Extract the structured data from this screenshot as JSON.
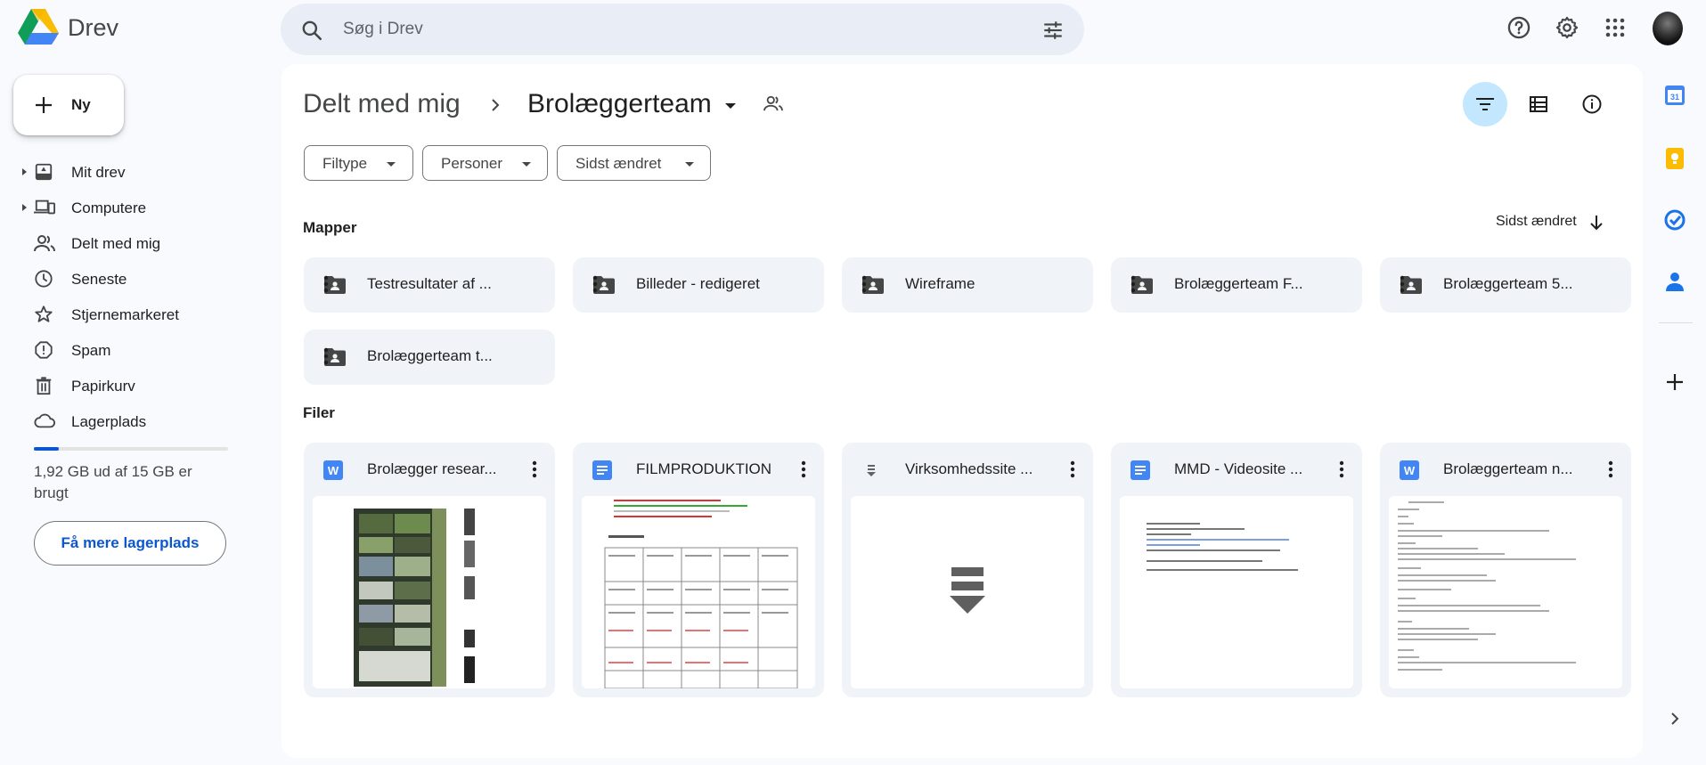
{
  "app": {
    "name": "Drev"
  },
  "search": {
    "placeholder": "Søg i Drev"
  },
  "sidebar": {
    "new_label": "Ny",
    "items": [
      {
        "label": "Mit drev",
        "icon": "my-drive-icon"
      },
      {
        "label": "Computere",
        "icon": "computers-icon"
      },
      {
        "label": "Delt med mig",
        "icon": "shared-icon"
      },
      {
        "label": "Seneste",
        "icon": "clock-icon"
      },
      {
        "label": "Stjernemarkeret",
        "icon": "star-icon"
      },
      {
        "label": "Spam",
        "icon": "spam-icon"
      },
      {
        "label": "Papirkurv",
        "icon": "trash-icon"
      },
      {
        "label": "Lagerplads",
        "icon": "cloud-icon"
      }
    ],
    "storage_used_fraction": 0.128,
    "storage_text": "1,92 GB ud af 15 GB er brugt",
    "more_storage_label": "Få mere lagerplads"
  },
  "breadcrumb": {
    "parent": "Delt med mig",
    "current": "Brolæggerteam"
  },
  "filters": {
    "type": "Filtype",
    "people": "Personer",
    "modified": "Sidst ændret"
  },
  "sections": {
    "folders": "Mapper",
    "files": "Filer"
  },
  "sort": {
    "label": "Sidst ændret",
    "direction": "descending"
  },
  "folders": [
    {
      "name": "Testresultater af ..."
    },
    {
      "name": "Billeder - redigeret"
    },
    {
      "name": "Wireframe"
    },
    {
      "name": "Brolæggerteam F..."
    },
    {
      "name": "Brolæggerteam 5..."
    },
    {
      "name": "Brolæggerteam t..."
    }
  ],
  "files": [
    {
      "name": "Brolægger resear...",
      "type": "word",
      "icon_letter": "W",
      "color": "#4285f4"
    },
    {
      "name": "FILMPRODUKTION",
      "type": "docs",
      "icon_letter": "",
      "color": "#4285f4"
    },
    {
      "name": "Virksomhedssite ...",
      "type": "download",
      "icon_letter": "",
      "color": "#5f6368"
    },
    {
      "name": "MMD - Videosite ...",
      "type": "docs-shortcut",
      "icon_letter": "",
      "color": "#4285f4"
    },
    {
      "name": "Brolæggerteam n...",
      "type": "word",
      "icon_letter": "W",
      "color": "#4285f4"
    }
  ],
  "colors": {
    "accent": "#0b57d0",
    "active_chip": "#c2e7ff",
    "surface": "#f0f4f9"
  }
}
